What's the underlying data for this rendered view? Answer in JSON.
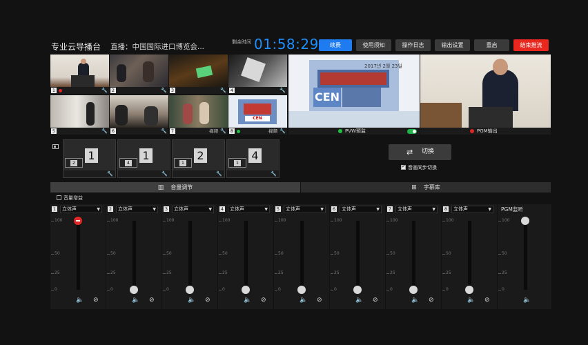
{
  "topbar": {
    "app_title": "专业云导播台",
    "live_title": "直播：中国国际进口博览会...",
    "remain_label": "剩余时间",
    "timer": "01:58:29",
    "buttons": [
      "续费",
      "使用须知",
      "操作日志",
      "输出设置",
      "重启",
      "结束推流"
    ]
  },
  "sources": [
    {
      "num": "1",
      "label": "",
      "dot": "#e02525"
    },
    {
      "num": "2",
      "label": "",
      "dot": ""
    },
    {
      "num": "3",
      "label": "",
      "dot": ""
    },
    {
      "num": "4",
      "label": "",
      "dot": ""
    },
    {
      "num": "5",
      "label": "",
      "dot": ""
    },
    {
      "num": "6",
      "label": "",
      "dot": ""
    },
    {
      "num": "7",
      "label": "视频",
      "dot": ""
    },
    {
      "num": "8",
      "label": "视频",
      "dot": "#22c040"
    }
  ],
  "pvw": {
    "label": "PVW预监",
    "dot": "#22c040",
    "banner": "CEN",
    "date": "2017년 2월 23일"
  },
  "pgm": {
    "label": "PGM输出",
    "dot": "#e02525"
  },
  "layouts": [
    {
      "main": "1",
      "pip": "2"
    },
    {
      "main": "1",
      "pip": "4"
    },
    {
      "main": "2",
      "pip": "1"
    },
    {
      "main": "4",
      "pip": "1"
    }
  ],
  "switch": {
    "label": "切换",
    "sync_label": "音画同步切换",
    "sync_checked": true
  },
  "tabs": [
    {
      "label": "音量调节",
      "active": true
    },
    {
      "label": "字幕库",
      "active": false
    }
  ],
  "gain_label": "音量增益",
  "mixer": {
    "scale": [
      "100",
      "50",
      "25",
      "0"
    ],
    "channels": [
      {
        "num": "1",
        "mode": "立体声",
        "level": 1.0
      },
      {
        "num": "2",
        "mode": "立体声",
        "level": 0.0
      },
      {
        "num": "3",
        "mode": "立体声",
        "level": 0.0
      },
      {
        "num": "4",
        "mode": "立体声",
        "level": 0.0
      },
      {
        "num": "5",
        "mode": "立体声",
        "level": 0.0
      },
      {
        "num": "6",
        "mode": "立体声",
        "level": 0.0
      },
      {
        "num": "7",
        "mode": "立体声",
        "level": 0.0
      },
      {
        "num": "8",
        "mode": "立体声",
        "level": 0.0
      }
    ],
    "pgm_listen_label": "PGM监听",
    "pgm_level": 1.0
  },
  "colors": {
    "accent_blue": "#1f7cf0",
    "danger_red": "#e8281f",
    "timer_blue": "#1e8fff",
    "live_green": "#22c040"
  }
}
